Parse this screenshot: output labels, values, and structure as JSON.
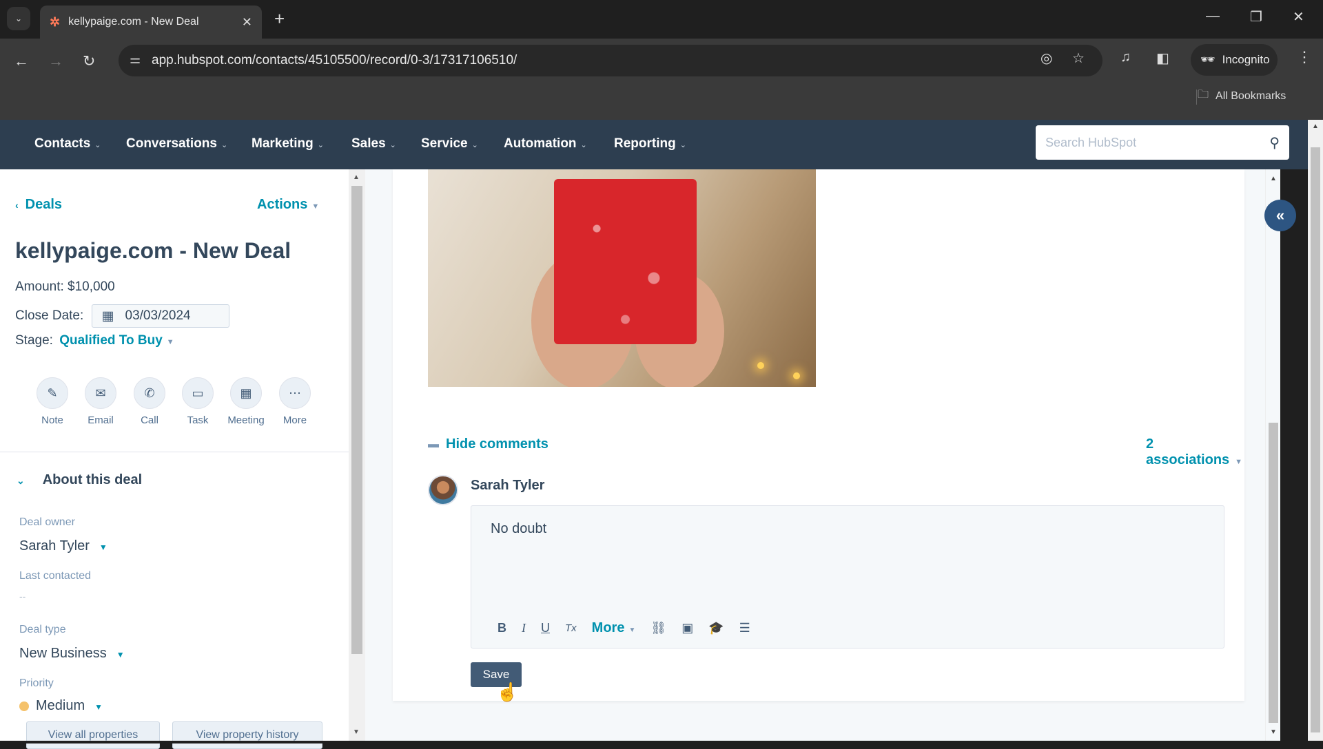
{
  "browser": {
    "tab_title": "kellypaige.com - New Deal",
    "url": "app.hubspot.com/contacts/45105500/record/0-3/17317106510/",
    "incognito_label": "Incognito",
    "bookmarks_label": "All Bookmarks"
  },
  "nav": {
    "items": [
      "Contacts",
      "Conversations",
      "Marketing",
      "Sales",
      "Service",
      "Automation",
      "Reporting"
    ],
    "search_placeholder": "Search HubSpot"
  },
  "sidebar": {
    "back_label": "Deals",
    "actions_label": "Actions",
    "deal_title": "kellypaige.com - New Deal",
    "amount_label": "Amount:",
    "amount_value": "$10,000",
    "close_date_label": "Close Date:",
    "close_date_value": "03/03/2024",
    "stage_label": "Stage:",
    "stage_value": "Qualified To Buy",
    "activities": [
      {
        "label": "Note",
        "icon": "note-icon"
      },
      {
        "label": "Email",
        "icon": "email-icon"
      },
      {
        "label": "Call",
        "icon": "call-icon"
      },
      {
        "label": "Task",
        "icon": "task-icon"
      },
      {
        "label": "Meeting",
        "icon": "meeting-icon"
      },
      {
        "label": "More",
        "icon": "more-icon"
      }
    ],
    "about_header": "About this deal",
    "fields": {
      "deal_owner_label": "Deal owner",
      "deal_owner_value": "Sarah Tyler",
      "last_contacted_label": "Last contacted",
      "last_contacted_value": "--",
      "deal_type_label": "Deal type",
      "deal_type_value": "New Business",
      "priority_label": "Priority",
      "priority_value": "Medium",
      "priority_color": "#f5c26b"
    },
    "view_all_label": "View all properties",
    "view_history_label": "View property history"
  },
  "main": {
    "hide_comments_label": "Hide comments",
    "associations_label": "2 associations",
    "comment_author": "Sarah Tyler",
    "comment_text": "No doubt",
    "toolbar": {
      "bold": "B",
      "italic": "I",
      "underline": "U",
      "clear": "Tx",
      "more": "More"
    },
    "save_label": "Save"
  },
  "colors": {
    "nav_bg": "#2d3e50",
    "link": "#0091ae",
    "save_bg": "#425b76"
  }
}
